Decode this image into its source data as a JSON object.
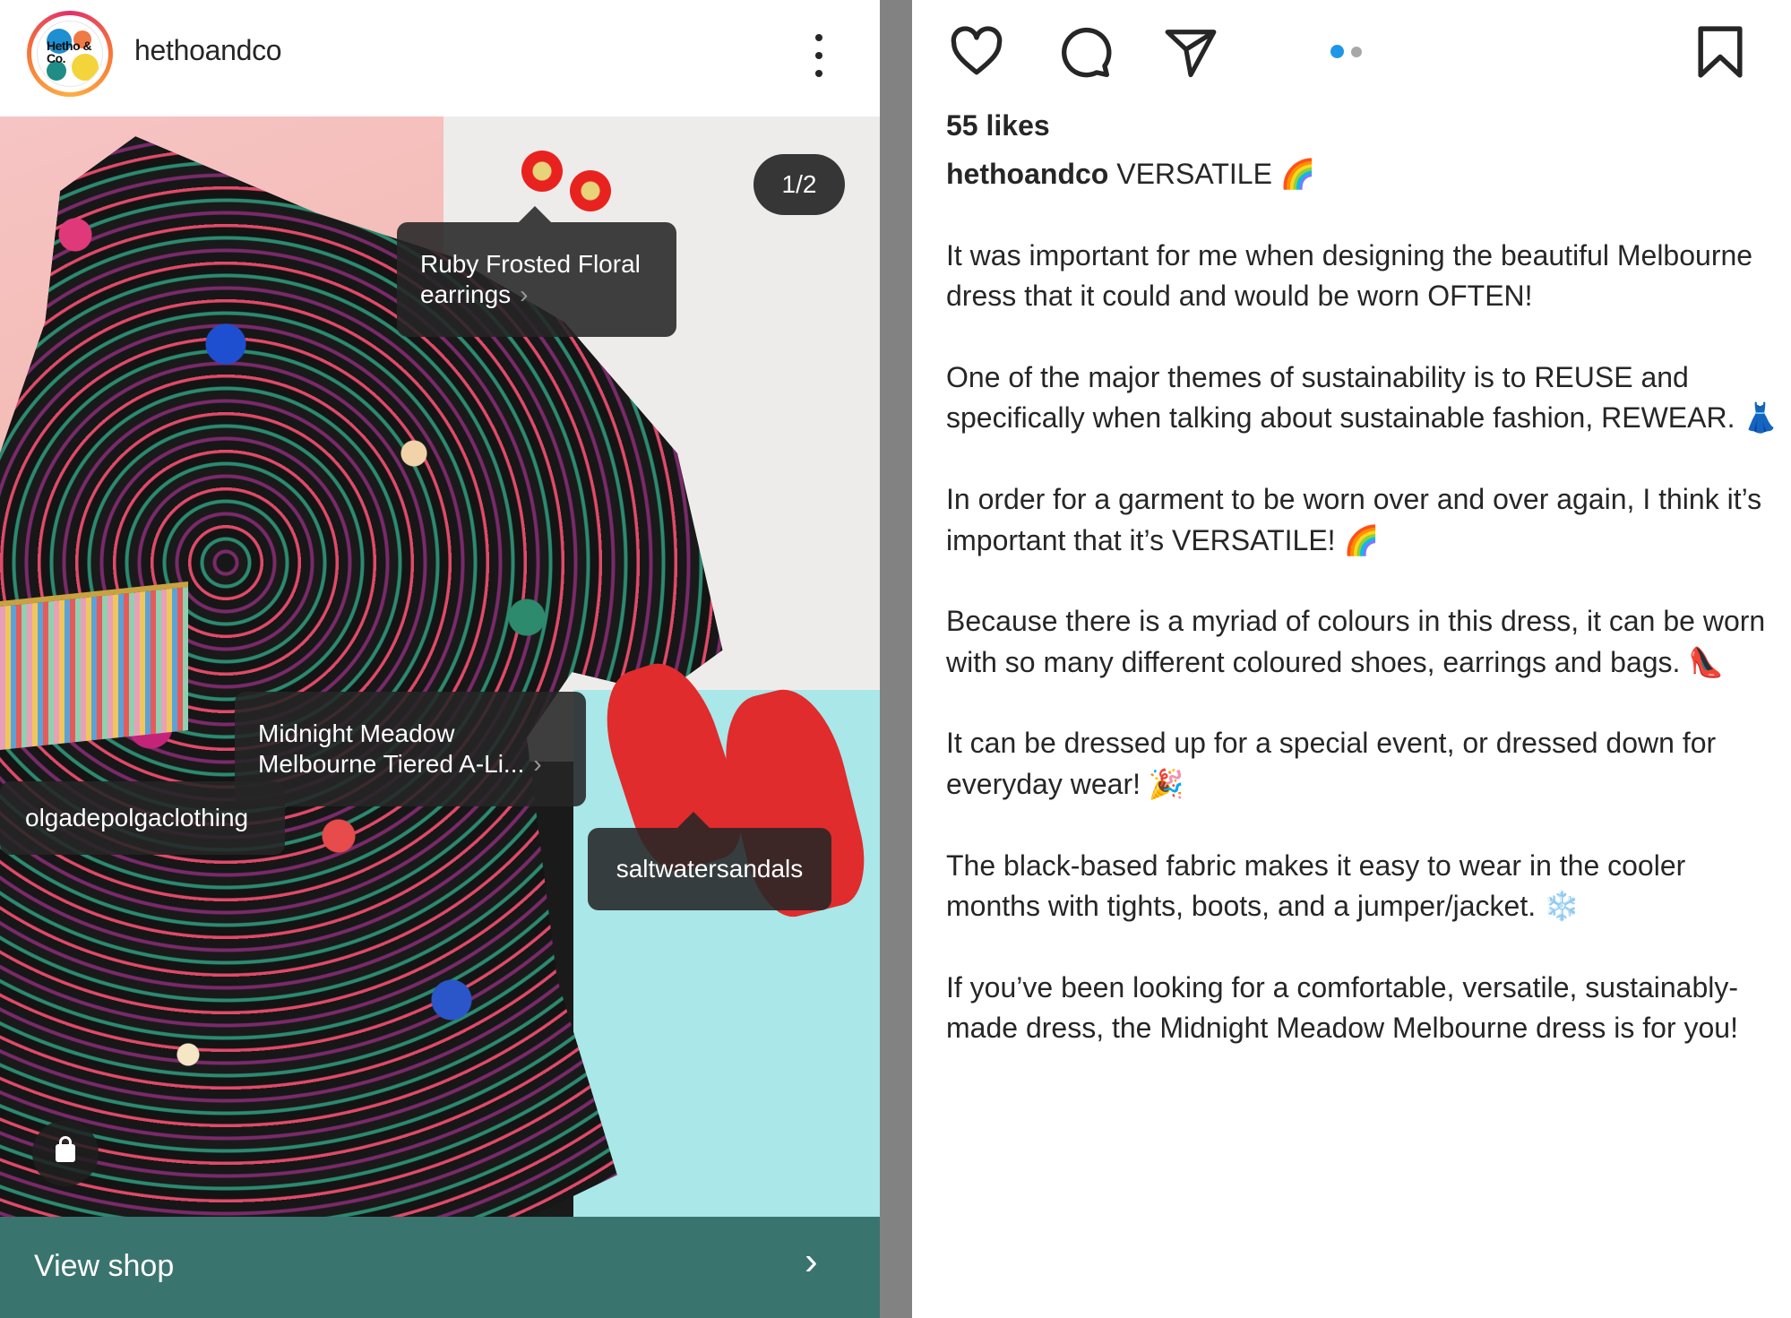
{
  "post": {
    "username": "hethoandco",
    "avatar_text": "Hetho & Co.",
    "slide_counter": "1/2",
    "current_slide": 1,
    "total_slides": 2
  },
  "tags": [
    {
      "line1": "Ruby Frosted Floral",
      "line2": "earrings",
      "has_chevron": true
    },
    {
      "line1": "Midnight Meadow",
      "line2": "Melbourne Tiered A-Li...",
      "has_chevron": true
    },
    {
      "line1": "olgadepolgaclothing"
    },
    {
      "line1": "saltwatersandals"
    }
  ],
  "icons": {
    "more": "more-vertical-icon",
    "like": "heart-outline-icon",
    "comment": "speech-bubble-icon",
    "share": "paper-plane-icon",
    "bookmark": "bookmark-outline-icon",
    "shop": "shopping-bag-icon",
    "tag_chevron": "›",
    "view_shop_chevron": "›"
  },
  "view_shop": {
    "label": "View shop"
  },
  "engagement": {
    "likes": "55 likes"
  },
  "caption": {
    "username": "hethoandco",
    "headline": "VERSATILE 🌈",
    "paragraphs": [
      "It was important for me when designing the beautiful Melbourne dress that it could and would be worn OFTEN!",
      "One of the major themes of sustainability is to REUSE and specifically when talking about sustainable fashion, REWEAR. 👗",
      "In order for a garment to be worn over and over again, I think it’s important that it’s VERSATILE! 🌈",
      "Because there is a myriad of colours in this dress, it can be worn with so many different coloured shoes, earrings and bags. 👠",
      "It can be dressed up for a special event, or dressed down for everyday wear! 🎉",
      "The black-based fabric makes it easy to wear in the cooler months with tights, boots, and a jumper/jacket. ❄️",
      "If you’ve been looking for a comfortable, versatile, sustainably-made dress, the Midnight Meadow Melbourne dress is for you!"
    ]
  },
  "colors": {
    "view_shop_bg": "#3a746f",
    "active_dot": "#1f97e8",
    "inactive_dot": "#a8a8a8",
    "divider": "#828282",
    "tag_bg": "#262626"
  }
}
